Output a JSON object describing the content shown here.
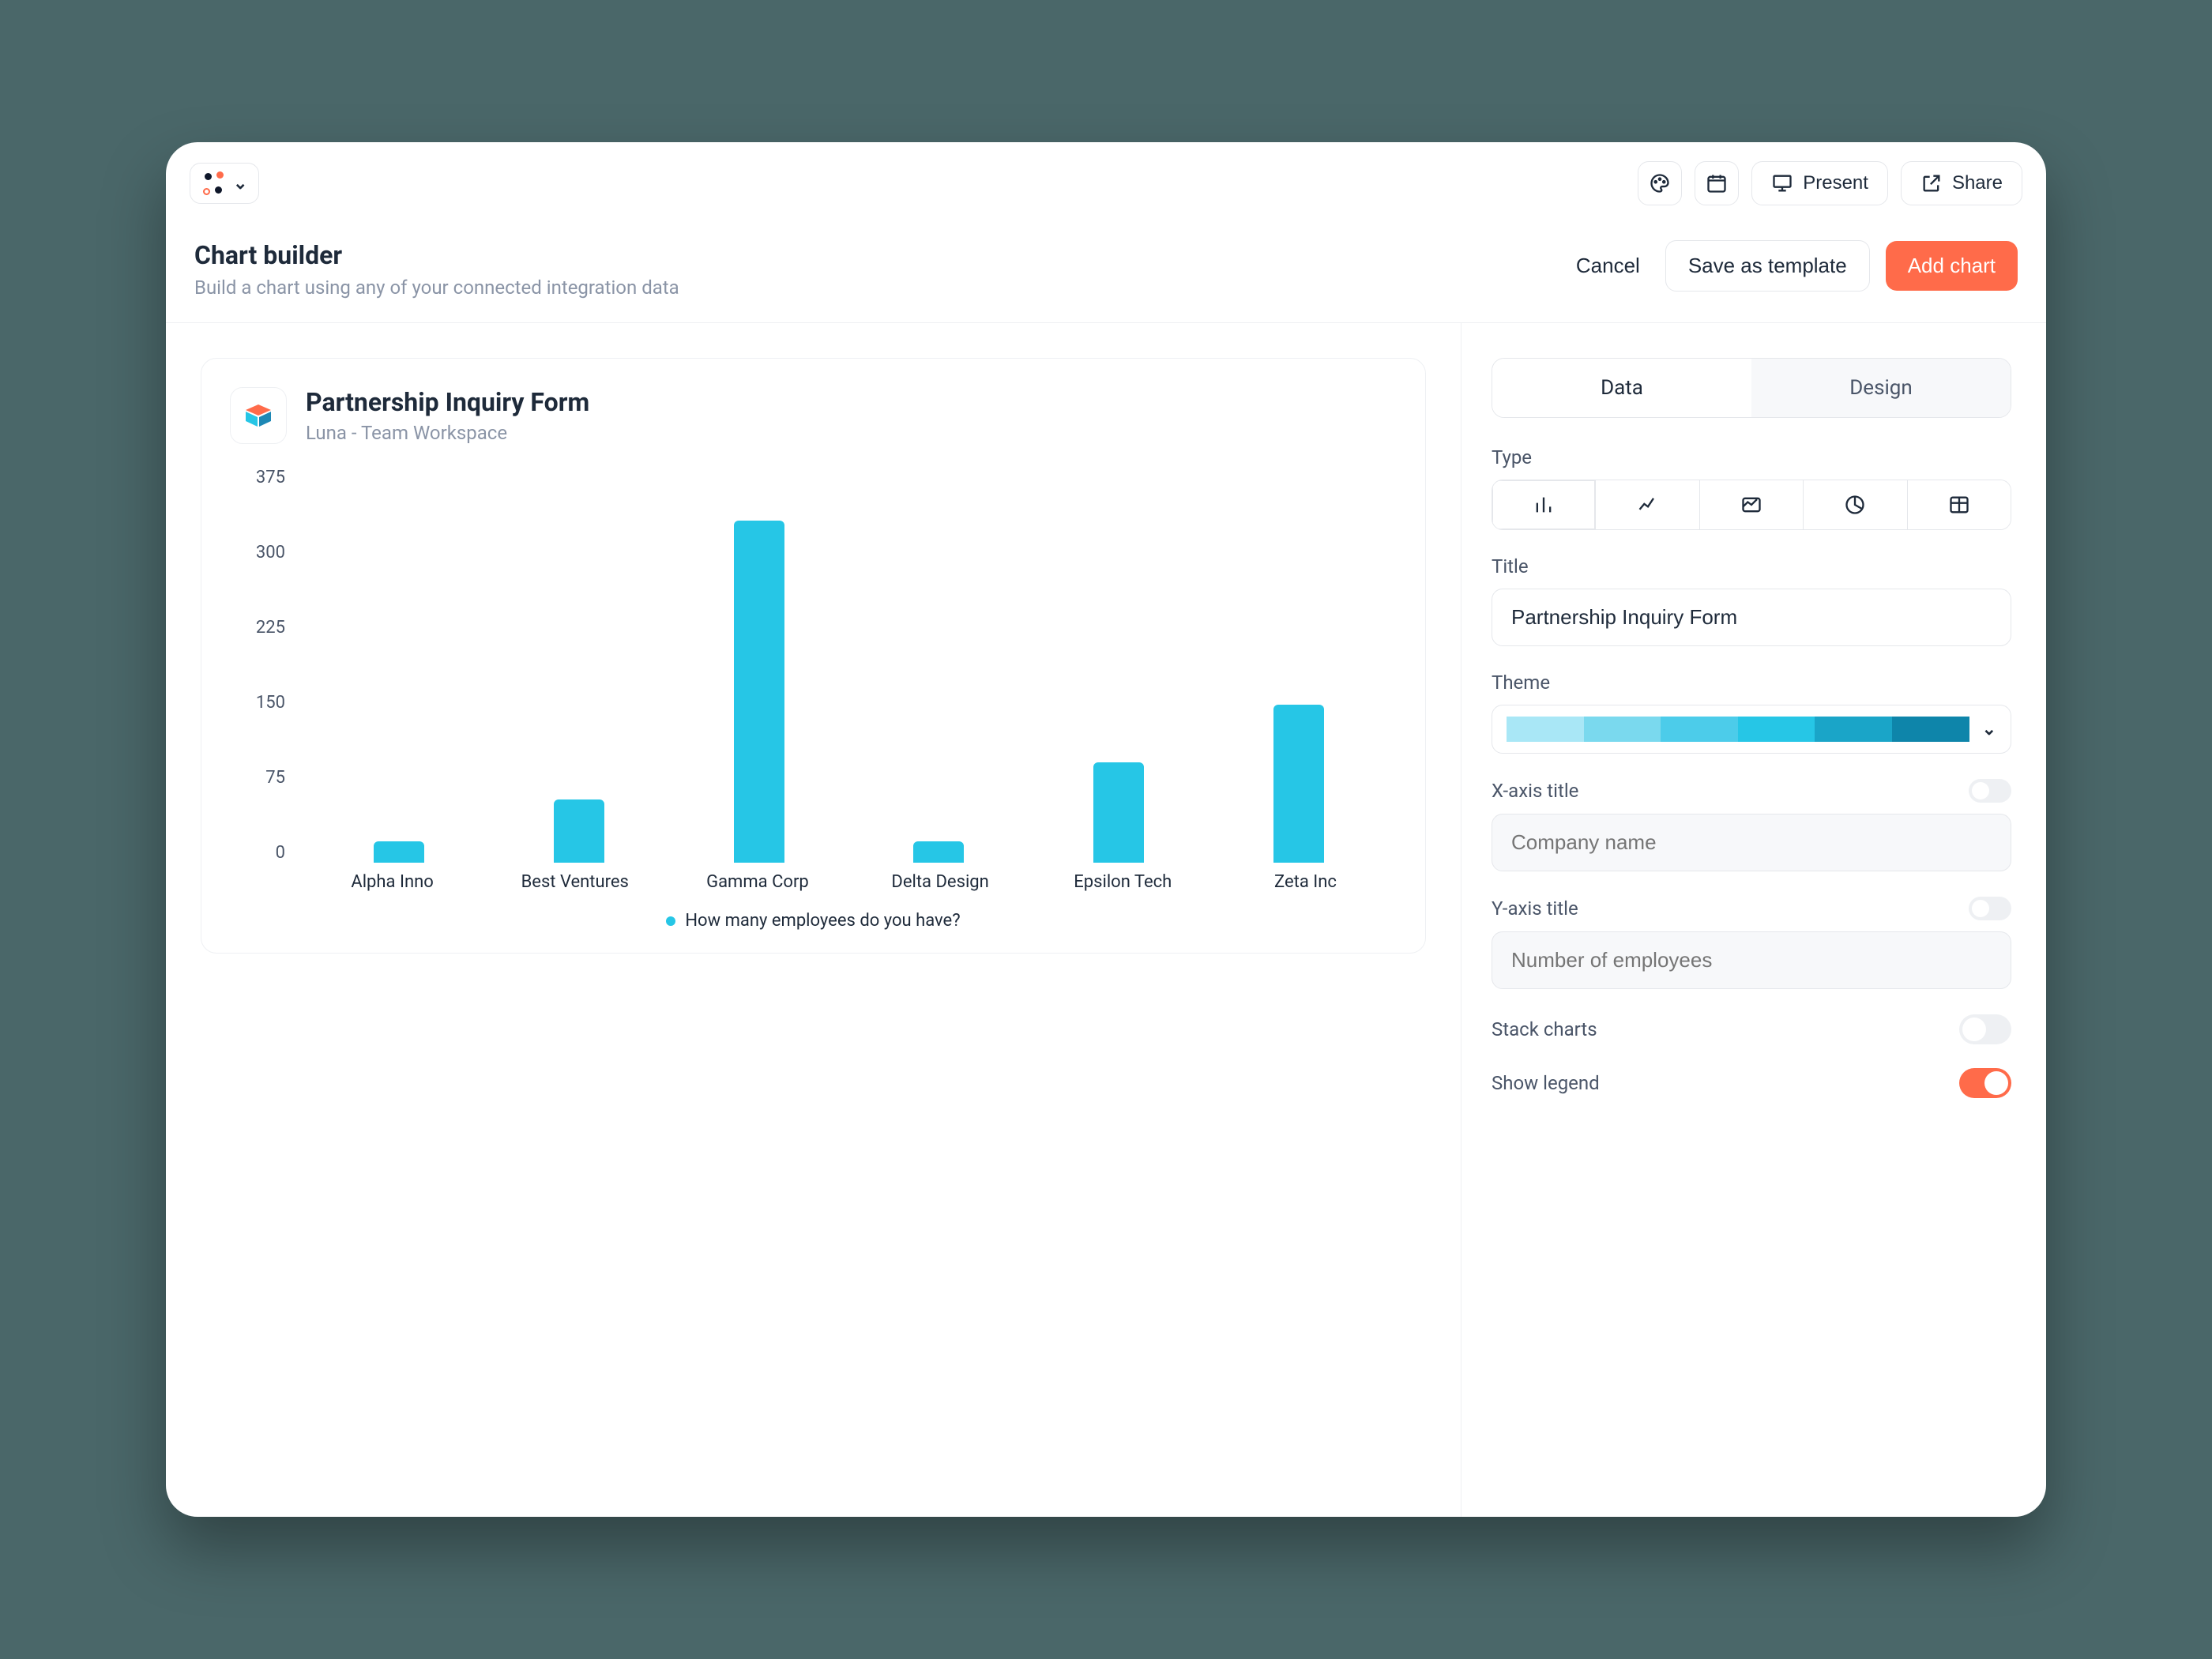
{
  "topbar": {
    "present_label": "Present",
    "share_label": "Share"
  },
  "header": {
    "title": "Chart builder",
    "subtitle": "Build a chart using any of your connected integration data",
    "cancel": "Cancel",
    "save_template": "Save as template",
    "add_chart": "Add chart"
  },
  "preview": {
    "title": "Partnership Inquiry Form",
    "subtitle": "Luna - Team Workspace",
    "legend_label": "How many employees do you have?"
  },
  "panel": {
    "tab_data": "Data",
    "tab_design": "Design",
    "type_label": "Type",
    "title_label": "Title",
    "title_value": "Partnership Inquiry Form",
    "theme_label": "Theme",
    "theme_colors": [
      "#a9e7f6",
      "#7ad9ee",
      "#4cccea",
      "#26c6e6",
      "#1aa5c8",
      "#0e85aa"
    ],
    "x_label": "X-axis title",
    "x_placeholder": "Company name",
    "y_label": "Y-axis title",
    "y_placeholder": "Number of employees",
    "stack_label": "Stack charts",
    "legend_toggle_label": "Show legend"
  },
  "chart_data": {
    "type": "bar",
    "categories": [
      "Alpha Inno",
      "Best Ventures",
      "Gamma Corp",
      "Delta Design",
      "Epsilon Tech",
      "Zeta Inc"
    ],
    "values": [
      20,
      60,
      325,
      20,
      95,
      150
    ],
    "title": "Partnership Inquiry Form",
    "xlabel": "",
    "ylabel": "",
    "ylim": [
      0,
      375
    ],
    "y_ticks": [
      375,
      300,
      225,
      150,
      75,
      0
    ],
    "series_name": "How many employees do you have?"
  }
}
